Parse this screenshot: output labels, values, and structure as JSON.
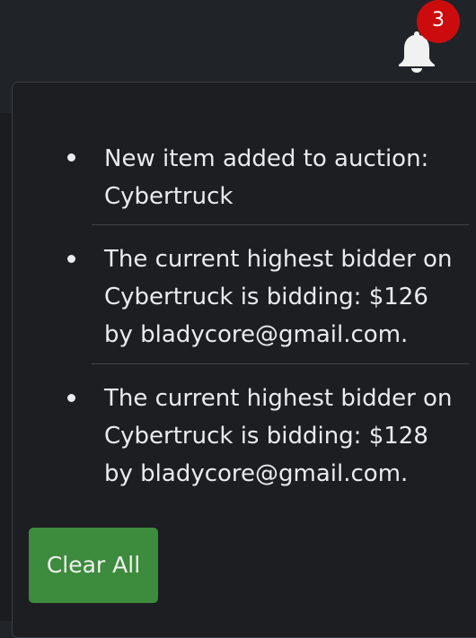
{
  "notifications": {
    "badge_count": "3",
    "items": [
      {
        "text": "New item added to auction: Cybertruck"
      },
      {
        "text": "The current highest bidder on Cybertruck is bidding: $126 by bladycore@gmail.com."
      },
      {
        "text": "The current highest bidder on Cybertruck is bidding: $128 by bladycore@gmail.com."
      }
    ],
    "clear_label": "Clear All"
  },
  "colors": {
    "badge": "#cc0c0c",
    "clear_button": "#3d8b3d",
    "dropdown_background": "#1c1e21",
    "text": "#e9ecef"
  },
  "icons": {
    "bell": "bell-icon",
    "bullet": "bullet-icon"
  }
}
